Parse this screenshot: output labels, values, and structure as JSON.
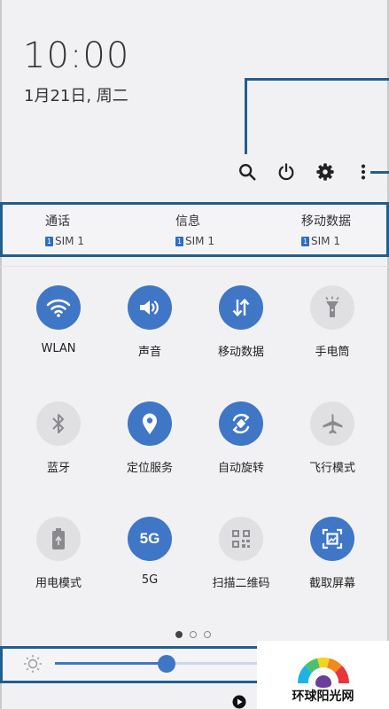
{
  "status": {
    "time": "10:00",
    "date": "1月21日, 周二"
  },
  "header_icons": [
    "search-icon",
    "power-icon",
    "gear-icon",
    "more-vertical-icon"
  ],
  "sim_info": [
    {
      "label": "通话",
      "sim": "SIM 1"
    },
    {
      "label": "信息",
      "sim": "SIM 1"
    },
    {
      "label": "移动数据",
      "sim": "SIM 1"
    }
  ],
  "sim_chip": "1",
  "quick_tiles": [
    {
      "label": "WLAN",
      "icon": "wifi-icon",
      "on": true
    },
    {
      "label": "声音",
      "icon": "sound-icon",
      "on": true
    },
    {
      "label": "移动数据",
      "icon": "mobile-data-icon",
      "on": true
    },
    {
      "label": "手电筒",
      "icon": "flashlight-icon",
      "on": false
    },
    {
      "label": "蓝牙",
      "icon": "bluetooth-icon",
      "on": false
    },
    {
      "label": "定位服务",
      "icon": "location-icon",
      "on": true
    },
    {
      "label": "自动旋转",
      "icon": "rotate-icon",
      "on": true
    },
    {
      "label": "飞行模式",
      "icon": "airplane-icon",
      "on": false
    },
    {
      "label": "用电模式",
      "icon": "battery-icon",
      "on": false
    },
    {
      "label": "5G",
      "icon": "5g-icon",
      "on": true
    },
    {
      "label": "扫描二维码",
      "icon": "qr-code-icon",
      "on": false
    },
    {
      "label": "截取屏幕",
      "icon": "screenshot-icon",
      "on": true
    }
  ],
  "tile_5g_text": "5G",
  "page_indicator": {
    "count": 3,
    "current": 1
  },
  "brightness": {
    "level": 0.5
  },
  "watermark": {
    "text": "环球阳光网"
  },
  "colors": {
    "accent": "#3f77c6",
    "annotation": "#1f5e8e"
  }
}
